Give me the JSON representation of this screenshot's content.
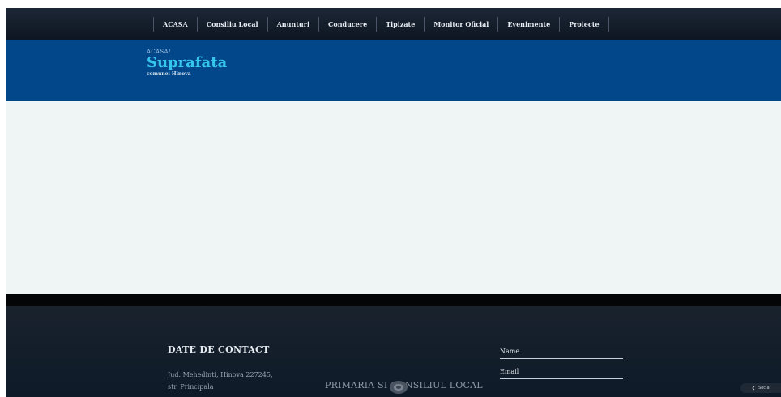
{
  "nav": {
    "items": [
      {
        "label": "ACASA"
      },
      {
        "label": "Consiliu Local"
      },
      {
        "label": "Anunturi"
      },
      {
        "label": "Conducere"
      },
      {
        "label": "Tipizate"
      },
      {
        "label": "Monitor Oficial"
      },
      {
        "label": "Evenimente"
      },
      {
        "label": "Proiecte"
      }
    ]
  },
  "header": {
    "breadcrumb": "ACASA/",
    "title": "Suprafata",
    "subtitle": "comunei Hinova"
  },
  "footer": {
    "contact_title": "DATE DE CONTACT",
    "address_line1": "Jud. Mehedinti, Hinova 227245,",
    "address_line2": "str. Principala",
    "brand_line1": "PRIMARIA SI CONSILIUL LOCAL",
    "form": {
      "name_label": "Name",
      "email_label": "Email"
    },
    "side_tab": "Social"
  },
  "colors": {
    "nav_bg": "#141e2b",
    "header_blue": "#03478b",
    "title_cyan": "#35c6ec",
    "content_bg": "#eff4f4",
    "footer_bg": "#121c28"
  }
}
